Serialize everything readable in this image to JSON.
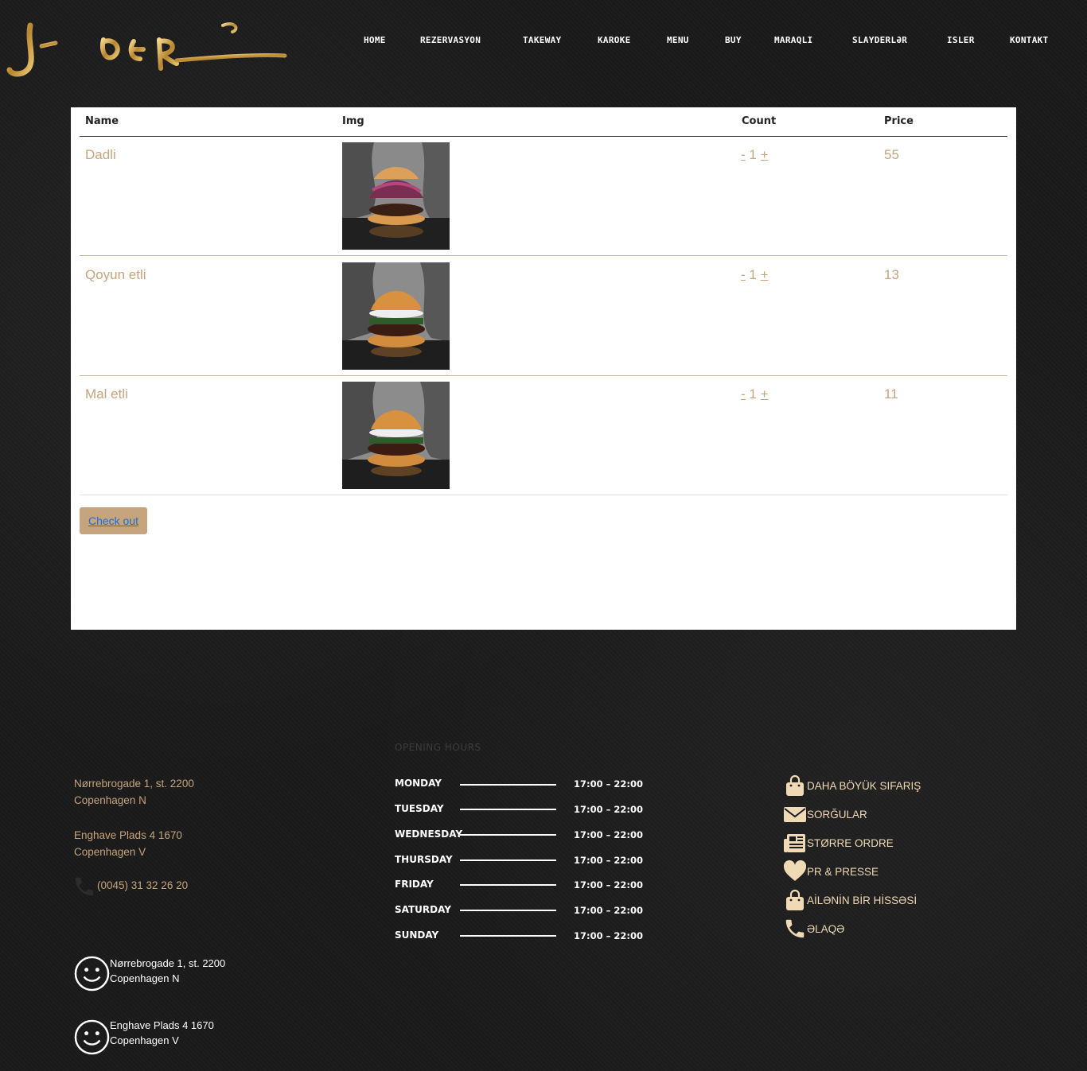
{
  "brand": {
    "logo_name": "sliders-gold-script-logo"
  },
  "nav": {
    "items": [
      "HOME",
      "REZERVASYON",
      "TAKEWAY",
      "KAROKE",
      "MENU",
      "BUY",
      "MARAQLI",
      "SLAYDERLƏR",
      "ISLER",
      "KONTAKT"
    ]
  },
  "cart": {
    "headers": {
      "name": "Name",
      "img": "Img",
      "count": "Count",
      "price": "Price"
    },
    "rows": [
      {
        "name": "Dadli",
        "image": "burger-red-onion-photo",
        "minus": "-",
        "count": "1",
        "plus": "+",
        "price": "55"
      },
      {
        "name": "Qoyun etli",
        "image": "burger-lamb-photo",
        "minus": "-",
        "count": "1",
        "plus": "+",
        "price": "13"
      },
      {
        "name": "Mal etli",
        "image": "burger-beef-photo",
        "minus": "-",
        "count": "1",
        "plus": "+",
        "price": "11"
      }
    ],
    "checkout_label": "Check out"
  },
  "footer": {
    "addresses": [
      {
        "line1": "Nørrebrogade 1, st. 2200",
        "line2": "Copenhagen N"
      },
      {
        "line1": "Enghave Plads 4 1670",
        "line2": "Copenhagen V"
      }
    ],
    "phone": "(0045) 31 32 26 20",
    "opening_hours": {
      "title": "OPENING HOURS",
      "days": [
        {
          "day": "MONDAY",
          "time": "17:00 – 22:00"
        },
        {
          "day": "TUESDAY",
          "time": "17:00 – 22:00"
        },
        {
          "day": "WEDNESDAY",
          "time": "17:00 – 22:00"
        },
        {
          "day": "THURSDAY",
          "time": "17:00 – 22:00"
        },
        {
          "day": "FRIDAY",
          "time": "17:00 – 22:00"
        },
        {
          "day": "SATURDAY",
          "time": "17:00 – 22:00"
        },
        {
          "day": "SUNDAY",
          "time": "17:00 – 22:00"
        }
      ]
    },
    "links": [
      {
        "label": "DAHA BÖYÜK SIFARIŞ",
        "icon": "shopping-bag-icon"
      },
      {
        "label": "SORĞULAR",
        "icon": "envelope-icon"
      },
      {
        "label": "STØRRE ORDRE",
        "icon": "newspaper-icon"
      },
      {
        "label": "PR & PRESSE",
        "icon": "heart-icon"
      },
      {
        "label": "AİLƏNİN BİR HİSSƏSİ",
        "icon": "shopping-bag-icon"
      },
      {
        "label": "ƏLAQƏ",
        "icon": "phone-icon"
      }
    ],
    "locations": [
      {
        "line1": "Nørrebrogade 1, st. 2200",
        "line2": "Copenhagen N",
        "icon": "smiley-icon"
      },
      {
        "line1": "Enghave Plads 4 1670",
        "line2": "Copenhagen V",
        "icon": "smiley-icon"
      }
    ]
  },
  "colors": {
    "background": "#1a1a1a",
    "gold": "#c5a47e",
    "link_cream": "#f0d9b5",
    "panel": "#ffffff",
    "checkout_link": "#1a6fd6"
  }
}
